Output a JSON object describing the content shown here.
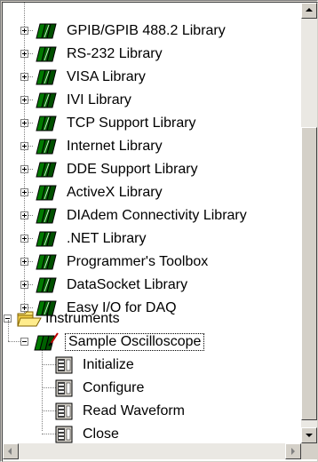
{
  "tree": {
    "libraries": [
      {
        "label": "GPIB/GPIB 488.2 Library"
      },
      {
        "label": "RS-232 Library"
      },
      {
        "label": "VISA Library"
      },
      {
        "label": "IVI Library"
      },
      {
        "label": "TCP Support Library"
      },
      {
        "label": "Internet Library"
      },
      {
        "label": "DDE Support Library"
      },
      {
        "label": "ActiveX Library"
      },
      {
        "label": "DIAdem Connectivity Library"
      },
      {
        "label": ".NET Library"
      },
      {
        "label": "Programmer's Toolbox"
      },
      {
        "label": "DataSocket Library"
      },
      {
        "label": "Easy I/O for DAQ"
      }
    ],
    "instruments_folder": "Instruments",
    "instrument": "Sample Oscilloscope",
    "functions": [
      {
        "label": "Initialize"
      },
      {
        "label": "Configure"
      },
      {
        "label": "Read Waveform"
      },
      {
        "label": "Close"
      }
    ]
  },
  "icons": {
    "library": "library-books-icon",
    "folder": "open-folder-icon",
    "instrument": "instrument-driver-icon",
    "function": "function-panel-icon"
  },
  "colors": {
    "library_book_green": "#007a00",
    "folder_yellow": "#ffe87a",
    "selection_border": "#000000"
  }
}
